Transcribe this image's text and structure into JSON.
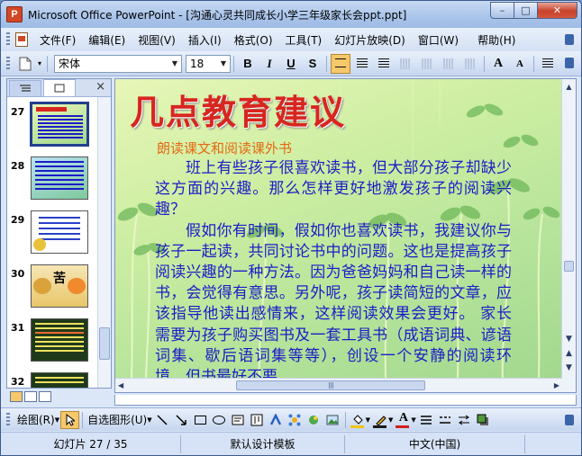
{
  "window": {
    "title": "Microsoft Office PowerPoint - [沟通心灵共同成长小学三年级家长会ppt.ppt]",
    "app_icon_letter": "P",
    "minimize": "–",
    "maximize": "□",
    "close": "✕"
  },
  "menu": {
    "items": [
      "文件(F)",
      "编辑(E)",
      "视图(V)",
      "插入(I)",
      "格式(O)",
      "工具(T)",
      "幻灯片放映(D)",
      "窗口(W)",
      "帮助(H)"
    ]
  },
  "toolbar": {
    "font_name": "宋体",
    "font_size": "18",
    "bold": "B",
    "italic": "I",
    "underline": "U",
    "shadow": "S",
    "grow_font": "A",
    "shrink_font": "A"
  },
  "slides_panel": {
    "close": "×",
    "thumbnails": [
      {
        "number": "27",
        "selected": true
      },
      {
        "number": "28",
        "selected": false
      },
      {
        "number": "29",
        "selected": false
      },
      {
        "number": "30",
        "selected": false,
        "label": "苦"
      },
      {
        "number": "31",
        "selected": false
      },
      {
        "number": "32",
        "selected": false
      }
    ]
  },
  "slide": {
    "title": "几点教育建议",
    "subtitle": "朗读课文和阅读课外书",
    "paragraph1": "班上有些孩子很喜欢读书，但大部分孩子却缺少这方面的兴趣。那么怎样更好地激发孩子的阅读兴趣？",
    "paragraph2": "假如你有时间，假如你也喜欢读书，我建议你与孩子一起读，共同讨论书中的问题。这也是提高孩子阅读兴趣的一种方法。因为爸爸妈妈和自己读一样的书，会觉得有意思。另外呢，孩子读简短的文章，应该指导他读出感情来，这样阅读效果会更好。 家长需要为孩子购买图书及一套工具书（成语词典、谚语词集、歇后语词集等等），创设一个安静的阅读环境，但书最好不要"
  },
  "drawing_toolbar": {
    "draw_label": "绘图(R)",
    "autoshapes_label": "自选图形(U)"
  },
  "status": {
    "slide_info": "幻灯片 27 / 35",
    "template": "默认设计模板",
    "language": "中文(中国)"
  },
  "colors": {
    "title_red": "#d8261f",
    "subtitle_orange": "#e36a12",
    "body_blue": "#1c1cc8",
    "office_blue": "#c6d6ef",
    "highlight": "#f7c86a"
  }
}
